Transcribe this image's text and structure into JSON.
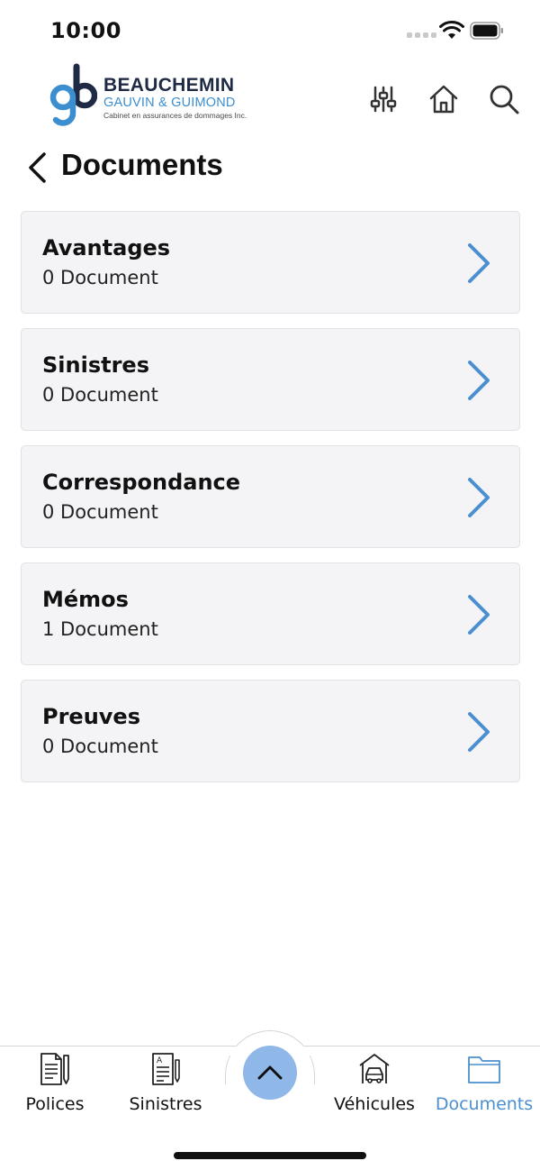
{
  "status_bar": {
    "time": "10:00"
  },
  "brand": {
    "line1": "BEAUCHEMIN",
    "line2": "GAUVIN & GUIMOND",
    "line3": "Cabinet en assurances de dommages Inc.",
    "colors": {
      "navy": "#1f2a44",
      "blue": "#3b8ed0"
    }
  },
  "header": {
    "icons": [
      "filter-icon",
      "home-icon",
      "search-icon"
    ]
  },
  "page": {
    "title": "Documents"
  },
  "categories": [
    {
      "title": "Avantages",
      "count": "0 Document"
    },
    {
      "title": "Sinistres",
      "count": "0 Document"
    },
    {
      "title": "Correspondance",
      "count": "0 Document"
    },
    {
      "title": "Mémos",
      "count": "1 Document"
    },
    {
      "title": "Preuves",
      "count": "0 Document"
    }
  ],
  "bottom_nav": {
    "items": [
      {
        "label": "Polices",
        "icon": "policy-document-icon"
      },
      {
        "label": "Sinistres",
        "icon": "claims-form-icon"
      },
      {
        "label": "Véhicules",
        "icon": "car-garage-icon"
      },
      {
        "label": "Documents",
        "icon": "folder-icon",
        "active": true
      }
    ],
    "center_button_icon": "chevron-up-icon"
  },
  "colors": {
    "accent": "#4a8fd0",
    "fab": "#8fb8e8",
    "card_bg": "#f4f4f7"
  }
}
